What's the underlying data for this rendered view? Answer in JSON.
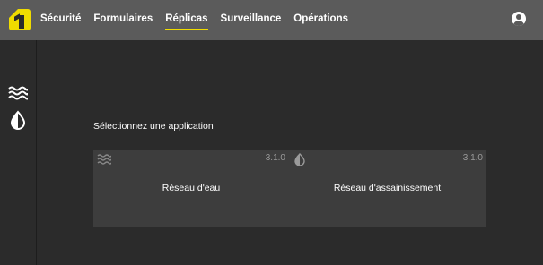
{
  "topbar": {
    "logo": "app-logo",
    "nav": [
      {
        "label": "Sécurité",
        "active": false
      },
      {
        "label": "Formulaires",
        "active": false
      },
      {
        "label": "Réplicas",
        "active": true
      },
      {
        "label": "Surveillance",
        "active": false
      },
      {
        "label": "Opérations",
        "active": false
      }
    ],
    "account_icon": "account-circle-icon"
  },
  "sidebar": {
    "items": [
      {
        "icon": "water-waves-icon"
      },
      {
        "icon": "half-drop-icon"
      }
    ]
  },
  "main": {
    "heading": "Sélectionnez une application",
    "apps": [
      {
        "icon": "water-waves-icon",
        "version": "3.1.0",
        "label": "Réseau d'eau"
      },
      {
        "icon": "half-drop-icon",
        "version": "3.1.0",
        "label": "Réseau d'assainissement"
      }
    ]
  },
  "colors": {
    "accent": "#f0dc00",
    "topbar": "#5b5b5b",
    "background": "#2b2b2b",
    "panel": "#3d3d3d"
  }
}
